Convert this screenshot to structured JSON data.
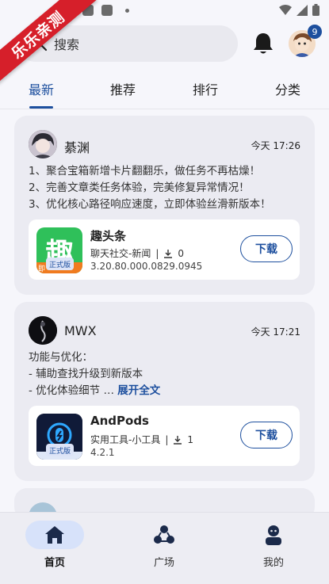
{
  "ribbon": {
    "text": "乐乐亲测"
  },
  "header": {
    "search_placeholder": "搜索",
    "notification_count": "9"
  },
  "tabs": [
    {
      "label": "最新",
      "active": true
    },
    {
      "label": "推荐",
      "active": false
    },
    {
      "label": "排行",
      "active": false
    },
    {
      "label": "分类",
      "active": false
    }
  ],
  "posts": [
    {
      "user": "綦渊",
      "time": "今天 17:26",
      "lines": [
        "1、聚合宝箱新增卡片翻翻乐，做任务不再枯燥！",
        "2、完善文章类任务体验，完美修复异常情况！",
        "3、优化核心路径响应速度，立即体验丝滑新版本！"
      ],
      "app": {
        "name": "趣头条",
        "icon_char": "趣",
        "category": "聊天社交-新闻",
        "downloads": "0",
        "version": "3.20.80.000.0829.0945",
        "tag": "正式版",
        "download_label": "下载",
        "icon_strip_text": "即"
      }
    },
    {
      "user": "MWX",
      "time": "今天 17:21",
      "lines": [
        "功能与优化：",
        "- 辅助查找升级到新版本",
        "- 优化体验细节 …"
      ],
      "expand_label": "展开全文",
      "app": {
        "name": "AndPods",
        "category": "实用工具-小工具",
        "downloads": "1",
        "version": "4.2.1",
        "tag": "正式版",
        "download_label": "下载"
      }
    }
  ],
  "bottom_nav": [
    {
      "label": "首页",
      "active": true
    },
    {
      "label": "广场",
      "active": false
    },
    {
      "label": "我的",
      "active": false
    }
  ],
  "colors": {
    "accent": "#1d4f9e",
    "ribbon": "#d61f2a",
    "card_bg": "#ebebf2",
    "page_bg": "#f6f6fb"
  }
}
